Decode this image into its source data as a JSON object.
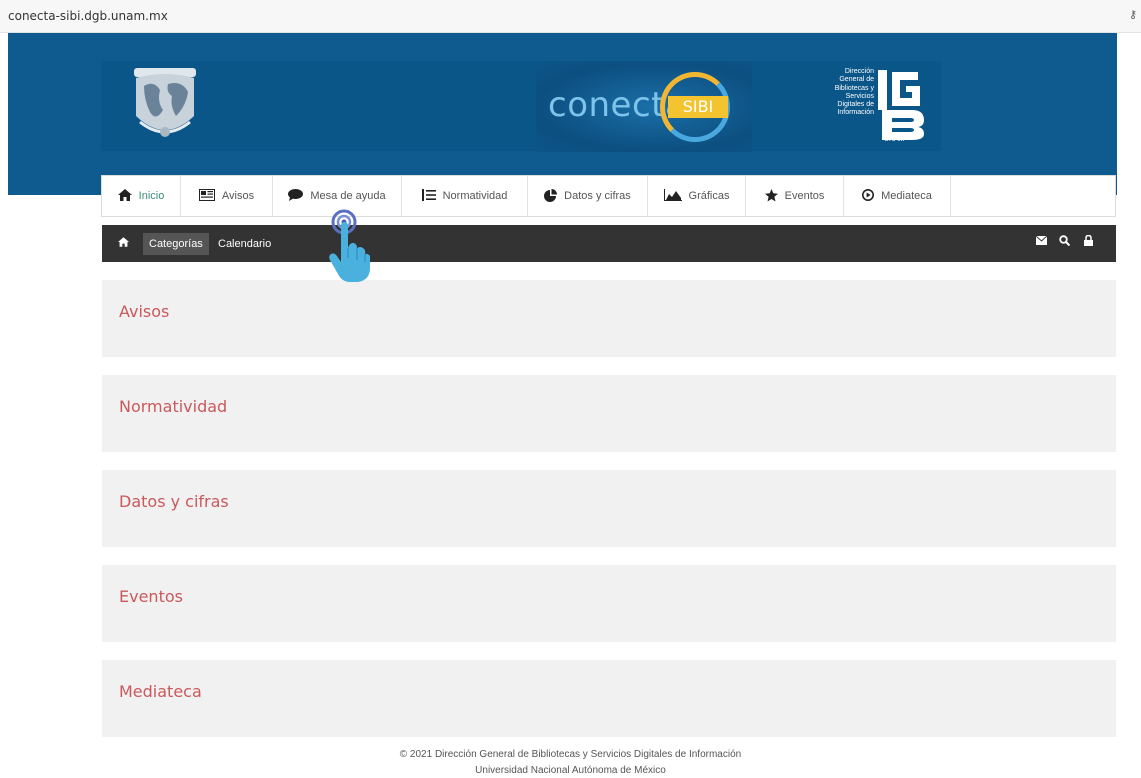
{
  "browser": {
    "url": "conecta-sibi.dgb.unam.mx",
    "key_icon": "key-icon"
  },
  "header": {
    "logo_word": "conecta",
    "logo_badge": "SIBI",
    "dgb_lines": [
      "Dirección",
      "General de",
      "Bibliotecas y",
      "Servicios",
      "Digitales de",
      "Información"
    ],
    "dgb_unam": "UNAM",
    "band_color": "#0f5a8e"
  },
  "nav": {
    "items": [
      {
        "label": "Inicio",
        "icon": "home-icon",
        "active": true
      },
      {
        "label": "Avisos",
        "icon": "newspaper-icon"
      },
      {
        "label": "Mesa de ayuda",
        "icon": "chat-bubble-icon"
      },
      {
        "label": "Normatividad",
        "icon": "list-icon"
      },
      {
        "label": "Datos y cifras",
        "icon": "pie-chart-icon"
      },
      {
        "label": "Gráficas",
        "icon": "area-chart-icon"
      },
      {
        "label": "Eventos",
        "icon": "star-icon"
      },
      {
        "label": "Mediateca",
        "icon": "play-circle-icon"
      }
    ],
    "active_color": "#3a8f78"
  },
  "subbar": {
    "categories": "Categorías",
    "calendar": "Calendario",
    "right_icons": [
      "envelope-icon",
      "search-icon",
      "lock-icon"
    ]
  },
  "sections": [
    {
      "title": "Avisos"
    },
    {
      "title": "Normatividad"
    },
    {
      "title": "Datos y cifras"
    },
    {
      "title": "Eventos"
    },
    {
      "title": "Mediateca"
    }
  ],
  "section_title_color": "#c9595c",
  "footer": {
    "line1": "© 2021 Dirección General de Bibliotecas y Servicios Digitales de Información",
    "line2": "Universidad Nacional Autónoma de México"
  }
}
